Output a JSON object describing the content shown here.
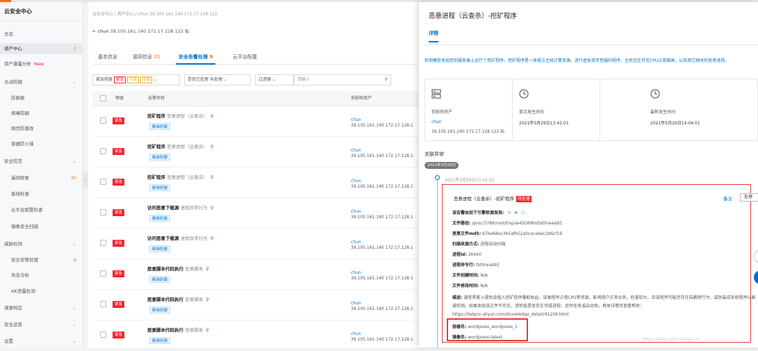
{
  "sidebar": {
    "title": "云安全中心",
    "items": [
      {
        "label": "总览",
        "type": "item"
      },
      {
        "label": "资产中心",
        "type": "item",
        "count": "1",
        "active": true
      },
      {
        "label": "资产暴露分析",
        "type": "item",
        "new": "New"
      },
      {
        "label": "主动防御",
        "type": "group"
      },
      {
        "label": "防勒索",
        "type": "sub"
      },
      {
        "label": "病毒防御",
        "type": "sub"
      },
      {
        "label": "网页防篡改",
        "type": "sub"
      },
      {
        "label": "容器防火墙",
        "type": "sub"
      },
      {
        "label": "安全防范",
        "type": "group"
      },
      {
        "label": "漏洞修复",
        "type": "sub",
        "count": "35"
      },
      {
        "label": "基线检查",
        "type": "sub"
      },
      {
        "label": "云平台配置检查",
        "type": "sub"
      },
      {
        "label": "镜像安全扫描",
        "type": "sub"
      },
      {
        "label": "威胁检测",
        "type": "group"
      },
      {
        "label": "安全告警处理",
        "type": "sub",
        "count": "9"
      },
      {
        "label": "攻击分析",
        "type": "sub"
      },
      {
        "label": "AK泄露检测",
        "type": "sub"
      },
      {
        "label": "调查响应",
        "type": "group"
      },
      {
        "label": "安全运营",
        "type": "group"
      },
      {
        "label": "设置",
        "type": "group"
      }
    ]
  },
  "main": {
    "breadcrumb": "云安全中心 / 资产中心 / chun 39.105.161.140 172.17.128.122",
    "back": {
      "host": "chun",
      "ip_public": "39.105.161.140",
      "ip_private": "172.17.128.122 私"
    },
    "tabs": [
      {
        "label": "基本信息",
        "count": ""
      },
      {
        "label": "漏洞信息",
        "count": "35"
      },
      {
        "label": "安全告警处理",
        "count": "9",
        "active": true
      },
      {
        "label": "云平台配置",
        "count": ""
      }
    ],
    "filters": {
      "level_label": "紧急程度",
      "tag_urgent": "紧急",
      "tag_suspicious": "可疑",
      "tag_hint": "提醒",
      "handled_label": "是否已处理",
      "handled_value": "未处理",
      "filter_label": "过滤器",
      "search_placeholder": "请输入"
    },
    "columns": {
      "level": "等级",
      "name": "告警名称",
      "asset": "受影响资产"
    },
    "rows": [
      {
        "level": "紧急",
        "name": "挖矿程序",
        "type": "恶意进程（云查杀）",
        "tag": "精准防御",
        "host": "chun",
        "ip": "39.105.161.140",
        "ip2": "172.17.128.1"
      },
      {
        "level": "紧急",
        "name": "挖矿程序",
        "type": "恶意进程（云查杀）",
        "tag": "精准防御",
        "host": "chun",
        "ip": "39.105.161.140",
        "ip2": "172.17.128.1"
      },
      {
        "level": "紧急",
        "name": "挖矿程序",
        "type": "恶意进程（云查杀）",
        "tag": "精准防御",
        "host": "chun",
        "ip": "39.105.161.140",
        "ip2": "172.17.128.1"
      },
      {
        "level": "紧急",
        "name": "访问恶意下载源",
        "type": "进程异常行为",
        "tag": "精准防御",
        "host": "chun",
        "ip": "39.105.161.140",
        "ip2": "172.17.128.1"
      },
      {
        "level": "紧急",
        "name": "访问恶意下载源",
        "type": "进程异常行为",
        "tag": "精准防御",
        "host": "chun",
        "ip": "39.105.161.140",
        "ip2": "172.17.128.1"
      },
      {
        "level": "紧急",
        "name": "恶意脚本代码执行",
        "type": "恶意脚本",
        "tag": "精准防御",
        "host": "chun",
        "ip": "39.105.161.140",
        "ip2": "172.17.128.1"
      },
      {
        "level": "紧急",
        "name": "恶意脚本代码执行",
        "type": "恶意脚本",
        "tag": "精准防御",
        "host": "chun",
        "ip": "39.105.161.140",
        "ip2": "172.17.128.1"
      },
      {
        "level": "紧急",
        "name": "恶意脚本代码执行",
        "type": "恶意脚本",
        "tag": "精准防御",
        "host": "chun",
        "ip": "39.105.161.140",
        "ip2": "172.17.128.1"
      }
    ]
  },
  "detail": {
    "title": "恶意进程（云查杀）-挖矿程序",
    "tab": "详情",
    "description": "检测模型发现您的服务器上运行了挖矿程序。挖矿程序是一类侵占主机计算资源，进行虚拟货币挖掘的程序，主机往往可见CPU占用飙高，以及其它相关的恶意进程。",
    "cards": [
      {
        "icon": "server-icon",
        "label": "受影响资产",
        "host": "chun",
        "ip": "39.105.161.140 172.17.128.122 私"
      },
      {
        "icon": "clock-icon",
        "label": "首次发生时间",
        "value": "2021年5月29日13:42:01"
      },
      {
        "icon": "clock-icon",
        "label": "最新发生时间",
        "value": "2021年5月29日14:04:01"
      }
    ],
    "section_title": "关联异常",
    "date_pill": "2021年5月29日",
    "event_time": "2021年5月29日13:42:01",
    "event": {
      "title": "恶意进程（云查杀）-挖矿程序",
      "badge": "待处理",
      "note": "备注",
      "handle": "处理",
      "engines_label": "该告警由如下引擎检测发现:",
      "fields": [
        {
          "k": "文件路径:",
          "v": "/proc/3789/root/tmp/w4SOR8to/[kthreaddi]"
        },
        {
          "k": "恶意文件md5:",
          "v": "97be68ec3b5afb52a0caca4ec2b6cf19"
        },
        {
          "k": "扫描来源方式:",
          "v": "进程启动扫描"
        },
        {
          "k": "进程id:",
          "v": "26440"
        },
        {
          "k": "进程命令行:",
          "v": "[kthreaddi]"
        },
        {
          "k": "文件创建时间:",
          "v": "N/A"
        },
        {
          "k": "文件修改时间:",
          "v": "N/A"
        }
      ],
      "desc_label": "描述:",
      "desc_value": "通常黑客入侵后会植入挖矿程序赚取收益，该类程序占用CPU等资源，影响用户正常业务，危害较大。且该程序可能还存在自删除行为、或伪装成系统程序以躲避检测。如果发现该文件不存在，请检查是否存在可疑进程、定时任务或启动项。具体详情可查看帮助：https://helpcn.aliyun.com/knowledge_detail/41206.html",
      "container_label": "容器名:",
      "container_value": "wordpress_wordpress_1",
      "image_label": "镜像名:",
      "image_value": "wordpress:latest"
    },
    "watermark": "https://blog.csdn.net/qq_42..."
  }
}
